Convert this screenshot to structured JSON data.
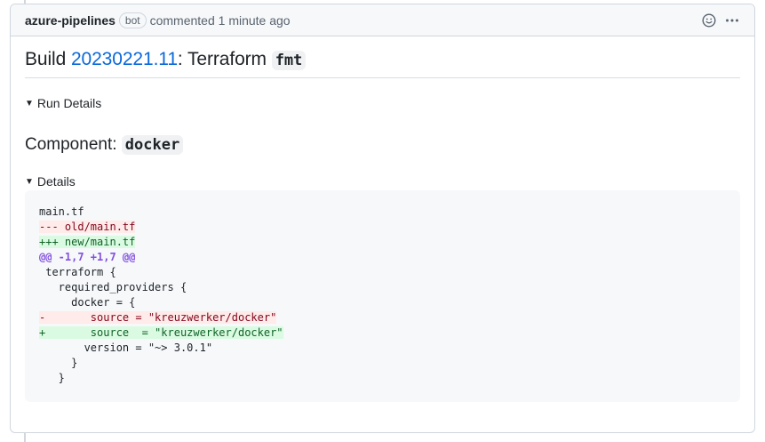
{
  "comment": {
    "author": "azure-pipelines",
    "badge": "bot",
    "action": "commented 1 minute ago"
  },
  "icons": [
    "smiley-icon",
    "kebab-horizontal-icon",
    "triangle-down-icon"
  ],
  "title": {
    "prefix": "Build ",
    "build_number": "20230221.11",
    "suffix": ": Terraform ",
    "code": "fmt"
  },
  "run_details": {
    "label": "Run Details"
  },
  "component": {
    "prefix": "Component: ",
    "name": "docker"
  },
  "details": {
    "label": "Details"
  },
  "diff": {
    "lines": [
      {
        "type": "context",
        "text": "main.tf"
      },
      {
        "type": "del",
        "text": "--- old/main.tf"
      },
      {
        "type": "add",
        "text": "+++ new/main.tf"
      },
      {
        "type": "hunk",
        "text": "@@ -1,7 +1,7 @@"
      },
      {
        "type": "context",
        "text": " terraform {"
      },
      {
        "type": "context",
        "text": "   required_providers {"
      },
      {
        "type": "context",
        "text": "     docker = {"
      },
      {
        "type": "del",
        "text": "-       source = \"kreuzwerker/docker\""
      },
      {
        "type": "add",
        "text": "+       source  = \"kreuzwerker/docker\""
      },
      {
        "type": "context",
        "text": "       version = \"~> 3.0.1\""
      },
      {
        "type": "context",
        "text": "     }"
      },
      {
        "type": "context",
        "text": "   }"
      }
    ]
  },
  "colors": {
    "link": "#0969da",
    "del_bg": "#ffebe9",
    "add_bg": "#dafbe1",
    "hunk": "#8250df"
  }
}
